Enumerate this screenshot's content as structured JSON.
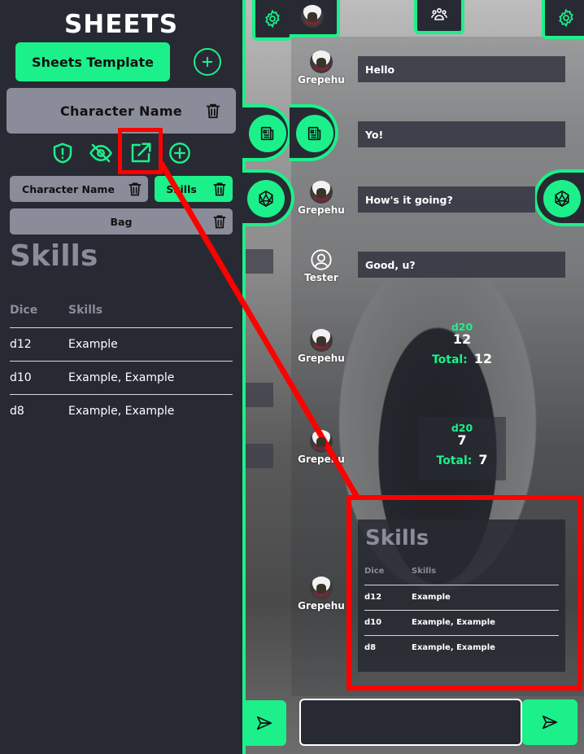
{
  "sheets": {
    "title": "SHEETS",
    "template_button": "Sheets Template",
    "character_name": "Character Name",
    "toolbar_icons": [
      "shield-alert-icon",
      "eye-off-icon",
      "external-link-icon",
      "plus-circle-icon"
    ],
    "tabs": [
      {
        "label": "Character Name",
        "active": false
      },
      {
        "label": "Skills",
        "active": true
      },
      {
        "label": "Bag",
        "active": false
      }
    ],
    "section_title": "Skills",
    "table": {
      "headers": [
        "Dice",
        "Skills"
      ],
      "rows": [
        [
          "d12",
          "Example"
        ],
        [
          "d10",
          "Example, Example"
        ],
        [
          "d8",
          "Example, Example"
        ]
      ]
    }
  },
  "chat": {
    "top_icons": [
      "settings-icon",
      "avatar",
      "group-icon",
      "settings-icon"
    ],
    "side_buttons": [
      "sheet-icon",
      "sheet-icon",
      "d20-icon",
      "d20-icon"
    ],
    "messages": [
      {
        "author": "Grepehu",
        "avatar": "cat",
        "type": "text",
        "text": "Hello"
      },
      {
        "author": "",
        "avatar": "",
        "type": "text",
        "text": "Yo!"
      },
      {
        "author": "Grepehu",
        "avatar": "cat",
        "type": "text",
        "text": "How's it going?"
      },
      {
        "author": "Tester",
        "avatar": "user-icon",
        "type": "text",
        "text": "Good, u?"
      },
      {
        "author": "Grepehu",
        "avatar": "cat",
        "type": "roll",
        "die": "d20",
        "value": "12",
        "total_label": "Total:",
        "total": "12"
      },
      {
        "author": "Grepehu",
        "avatar": "cat",
        "type": "roll",
        "die": "d20",
        "value": "7",
        "total_label": "Total:",
        "total": "7"
      },
      {
        "author": "Grepehu",
        "avatar": "cat",
        "type": "embed",
        "title": "Skills",
        "headers": [
          "Dice",
          "Skills"
        ],
        "rows": [
          [
            "d12",
            "Example"
          ],
          [
            "d10",
            "Example, Example"
          ],
          [
            "d8",
            "Example, Example"
          ]
        ]
      }
    ],
    "input": {
      "value": "",
      "placeholder": ""
    }
  },
  "colors": {
    "accent": "#1cf08a",
    "panel": "#272a33",
    "muted": "#8a8d99",
    "annotation": "#ff0000"
  }
}
